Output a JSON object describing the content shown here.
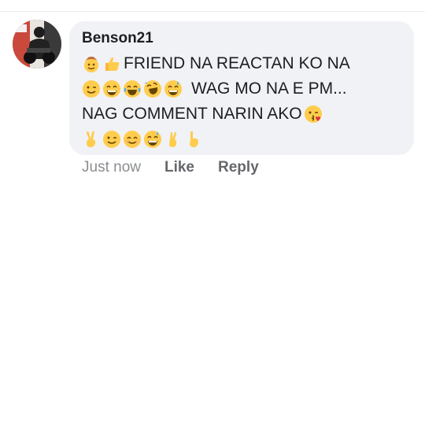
{
  "comment": {
    "author": "Benson21",
    "line1": {
      "emojis": [
        "cowboy-face-emoji",
        "thumbs-up-emoji"
      ],
      "text": "FRIEND NA REACTAN KO NA"
    },
    "line2": {
      "emojis": [
        "wink-emoji",
        "grin-emoji",
        "tears-of-joy-emoji",
        "rofl-emoji",
        "grin-sweat-emoji"
      ],
      "text": "WAG MO NA E PM..."
    },
    "line3": {
      "text": "NAG COMMENT NARIN AKO",
      "emojis": [
        "kissing-heart-emoji"
      ]
    },
    "line4": {
      "emojis": [
        "victory-hand-emoji",
        "wink-emoji",
        "smiling-eyes-emoji",
        "grin-sweat-emoji",
        "crossed-fingers-emoji",
        "point-up-emoji"
      ]
    }
  },
  "actions": {
    "timestamp": "Just now",
    "like_label": "Like",
    "reply_label": "Reply"
  },
  "colors": {
    "bubble": "#f0f2f5",
    "emoji_yellow": "#ffcc4d",
    "secondary_text": "#65676b"
  }
}
